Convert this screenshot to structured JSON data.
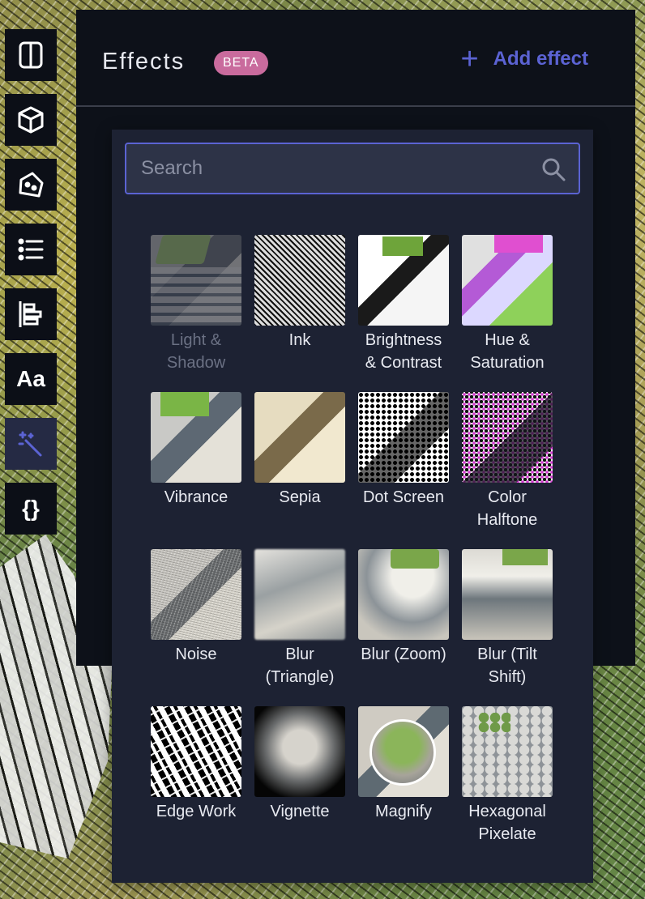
{
  "toolbar": {
    "items": [
      {
        "name": "split-view",
        "icon": "split-panel-icon"
      },
      {
        "name": "3d-object",
        "icon": "cube-icon"
      },
      {
        "name": "geometry",
        "icon": "polygon-icon"
      },
      {
        "name": "layers-list",
        "icon": "list-icon"
      },
      {
        "name": "legend",
        "icon": "bar-align-icon"
      },
      {
        "name": "text",
        "icon": "text-icon",
        "text": "Aa"
      },
      {
        "name": "effects",
        "icon": "magic-wand-icon",
        "active": true
      },
      {
        "name": "json-editor",
        "icon": "braces-icon",
        "text": "{}"
      }
    ]
  },
  "panel": {
    "title": "Effects",
    "badge": "BETA",
    "add_effect_label": "Add effect"
  },
  "search": {
    "placeholder": "Search"
  },
  "effects": [
    {
      "label": "Light & Shadow",
      "disabled": true
    },
    {
      "label": "Ink"
    },
    {
      "label": "Brightness & Contrast"
    },
    {
      "label": "Hue & Saturation"
    },
    {
      "label": "Vibrance"
    },
    {
      "label": "Sepia"
    },
    {
      "label": "Dot Screen"
    },
    {
      "label": "Color Halftone"
    },
    {
      "label": "Noise"
    },
    {
      "label": "Blur (Triangle)"
    },
    {
      "label": "Blur (Zoom)"
    },
    {
      "label": "Blur (Tilt Shift)"
    },
    {
      "label": "Edge Work"
    },
    {
      "label": "Vignette"
    },
    {
      "label": "Magnify"
    },
    {
      "label": "Hexagonal Pixelate"
    }
  ],
  "colors": {
    "accent": "#5b63d3",
    "badge": "#c96b9d",
    "panel_bg": "#0d1119",
    "popup_bg": "#1d2233"
  }
}
